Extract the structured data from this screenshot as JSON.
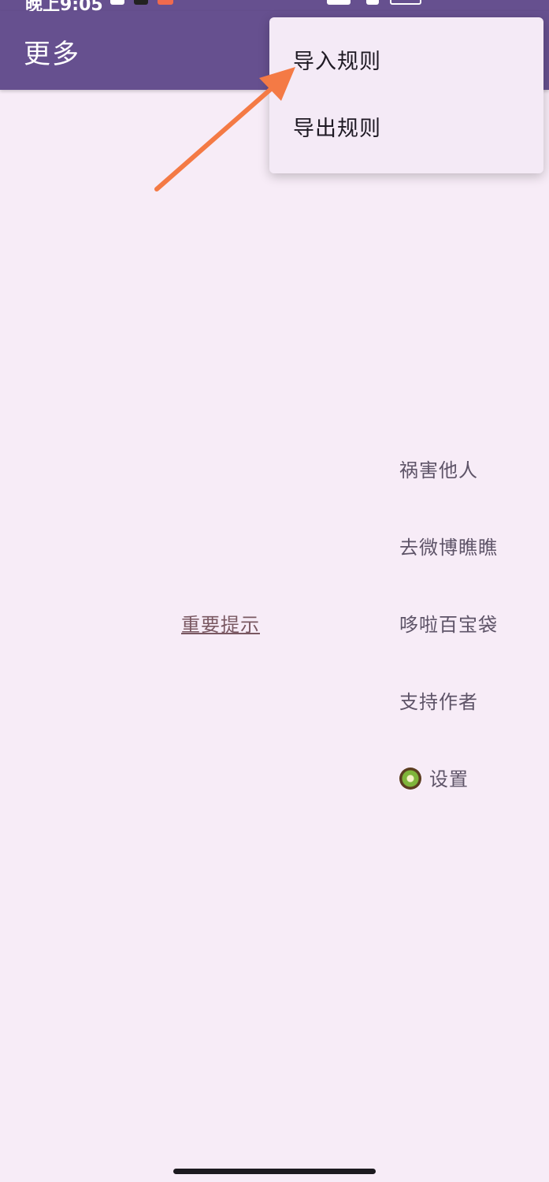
{
  "status_bar": {
    "time": "晚上9:05"
  },
  "app_bar": {
    "title": "更多"
  },
  "overflow_menu": {
    "items": [
      {
        "label": "导入规则"
      },
      {
        "label": "导出规则"
      }
    ]
  },
  "side_menu": {
    "items": [
      {
        "label": "祸害他人"
      },
      {
        "label": "去微博瞧瞧"
      },
      {
        "label": "哆啦百宝袋"
      },
      {
        "label": "支持作者"
      },
      {
        "label": "设置",
        "icon": "kiwi-icon"
      }
    ]
  },
  "main": {
    "notice_link": "重要提示"
  },
  "colors": {
    "app_bar": "#66508f",
    "background": "#f7ecf7",
    "menu_background": "#f4eaf6",
    "arrow": "#f47a45"
  }
}
